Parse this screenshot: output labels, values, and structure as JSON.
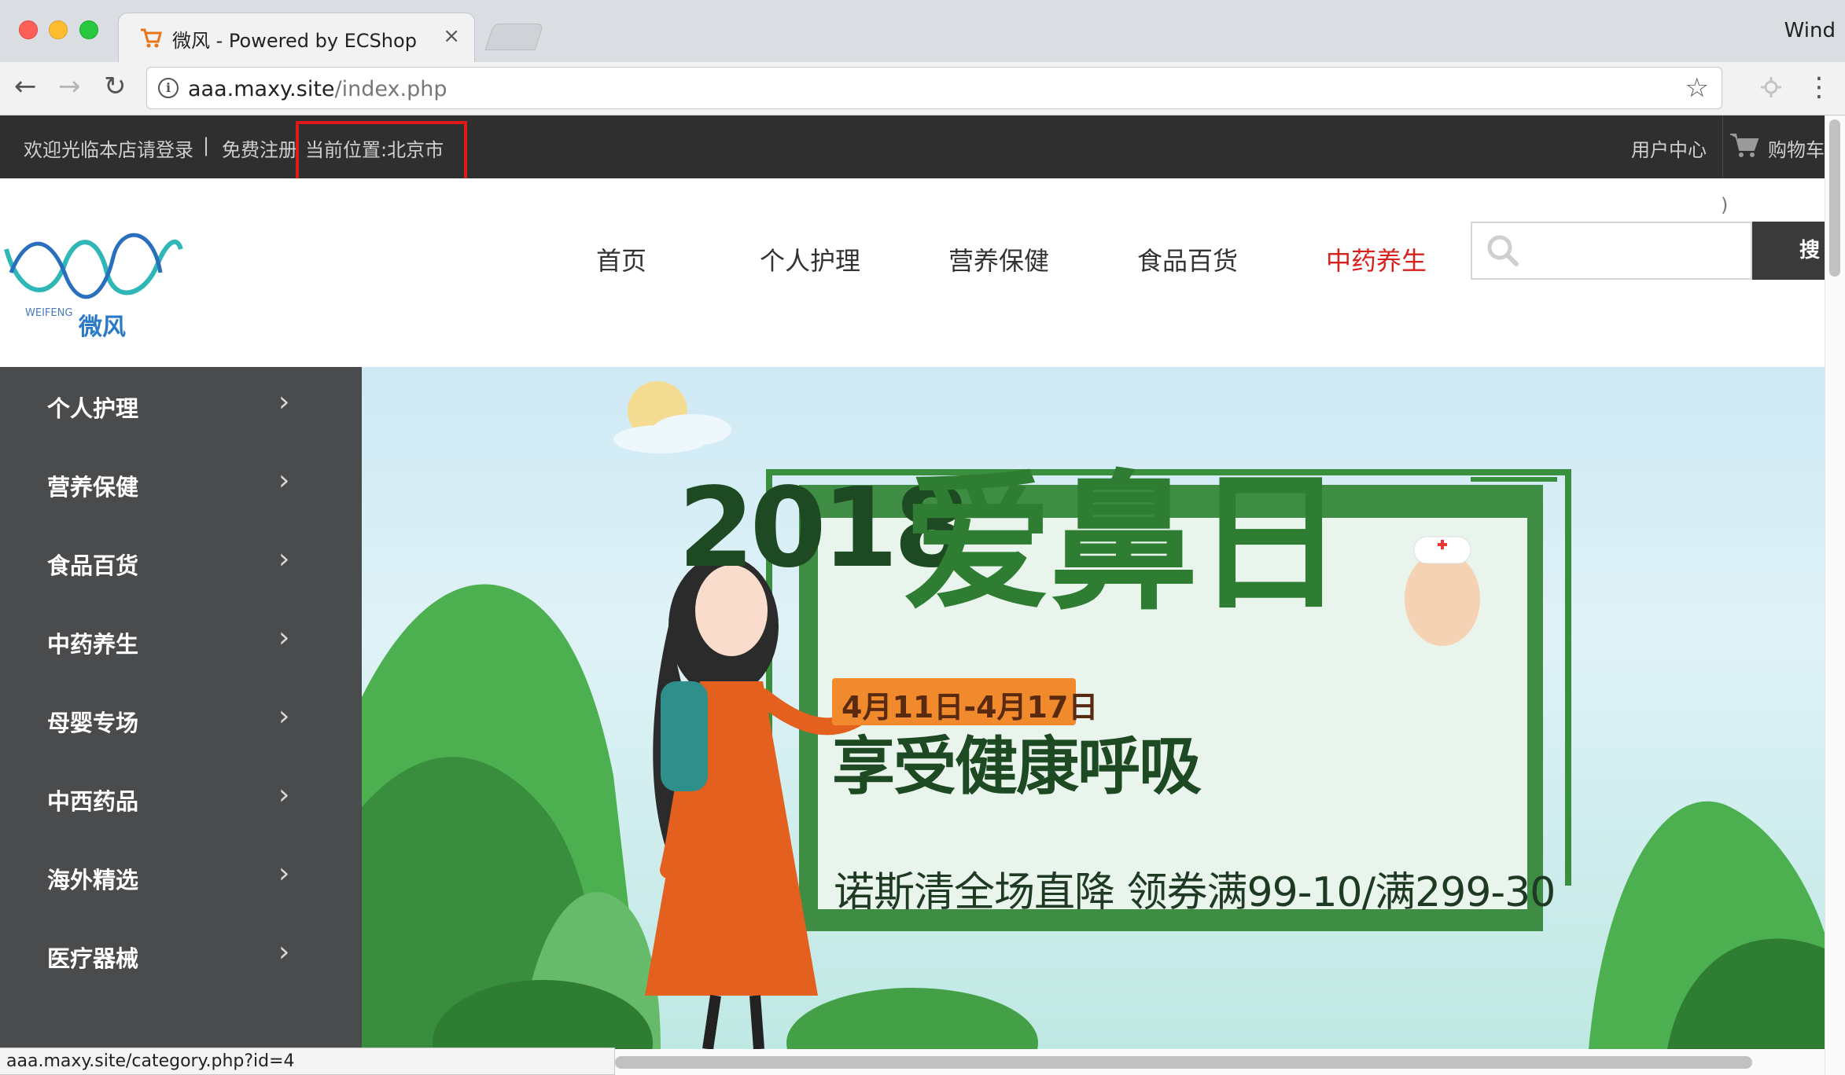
{
  "browser": {
    "tab_title": "微风 - Powered by ECShop",
    "tab_close": "×",
    "window_label": "Wind",
    "url_host": "aaa.maxy.site",
    "url_path": "/index.php",
    "back": "←",
    "forward": "→",
    "reload": "↻",
    "info": "i",
    "star": "☆",
    "menu": "⋮",
    "status_url": "aaa.maxy.site/category.php?id=4"
  },
  "topbar": {
    "welcome": "欢迎光临本店请登录",
    "separator": "|",
    "register": "免费注册",
    "location": "当前位置:北京市",
    "user_center": "用户中心",
    "cart": "购物车"
  },
  "header": {
    "logo_en": "WEIFENG",
    "logo_cn": "微风",
    "stray_char": ")",
    "nav": [
      {
        "label": "首页",
        "active": false
      },
      {
        "label": "个人护理",
        "active": false
      },
      {
        "label": "营养保健",
        "active": false
      },
      {
        "label": "食品百货",
        "active": false
      },
      {
        "label": "中药养生",
        "active": true
      }
    ],
    "search_button": "搜"
  },
  "categories": [
    {
      "label": "个人护理"
    },
    {
      "label": "营养保健"
    },
    {
      "label": "食品百货"
    },
    {
      "label": "中药养生"
    },
    {
      "label": "母婴专场"
    },
    {
      "label": "中西药品"
    },
    {
      "label": "海外精选"
    },
    {
      "label": "医疗器械"
    }
  ],
  "category_arrow": "›",
  "banner": {
    "year": "2018",
    "headline": "爱鼻日",
    "date_range": "4月11日-4月17日",
    "subtitle": "享受健康呼吸",
    "promo": "诺斯清全场直降 领券满99-10/满299-30"
  },
  "colors": {
    "accent": "#d8201d",
    "topbar_bg": "#2f2f2f",
    "sidemenu_bg": "#4a4b4d",
    "banner_green": "#2e7d32",
    "highlight_red": "#e0191b"
  }
}
